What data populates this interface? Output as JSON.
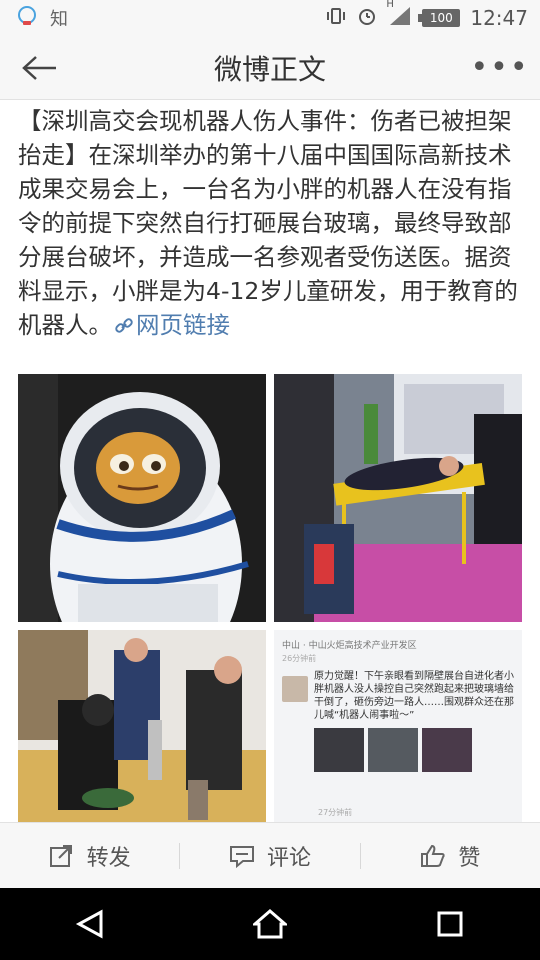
{
  "status_bar": {
    "app_label": "知",
    "battery": "100",
    "time": "12:47",
    "network": "H"
  },
  "nav": {
    "title": "微博正文",
    "more": "•••"
  },
  "post": {
    "text": "【深圳高交会现机器人伤人事件：伤者已被担架抬走】在深圳举办的第十八届中国国际高新技术成果交易会上，一台名为小胖的机器人在没有指令的前提下突然自行打砸展台玻璃，最终导致部分展台破坏，并造成一名参观者受伤送医。据资料显示，小胖是为4-12岁儿童研发，用于教育的机器人。",
    "link_text": "网页链接"
  },
  "screenshot_card": {
    "source": "中山 · 中山火炬高技术产业开发区",
    "time_top": "26分钟前",
    "body": "原力觉醒！下午亲眼看到隔壁展台自进化者小胖机器人没人操控自己突然跑起来把玻璃墙给干倒了，砸伤旁边一路人……围观群众还在那儿喊“机器人闹事啦～”",
    "time_bottom": "27分钟前"
  },
  "actions": {
    "repost": "转发",
    "comment": "评论",
    "like": "赞"
  },
  "colors": {
    "link": "#507daf",
    "bar_bg": "#f7f7f7",
    "text": "#333333"
  }
}
